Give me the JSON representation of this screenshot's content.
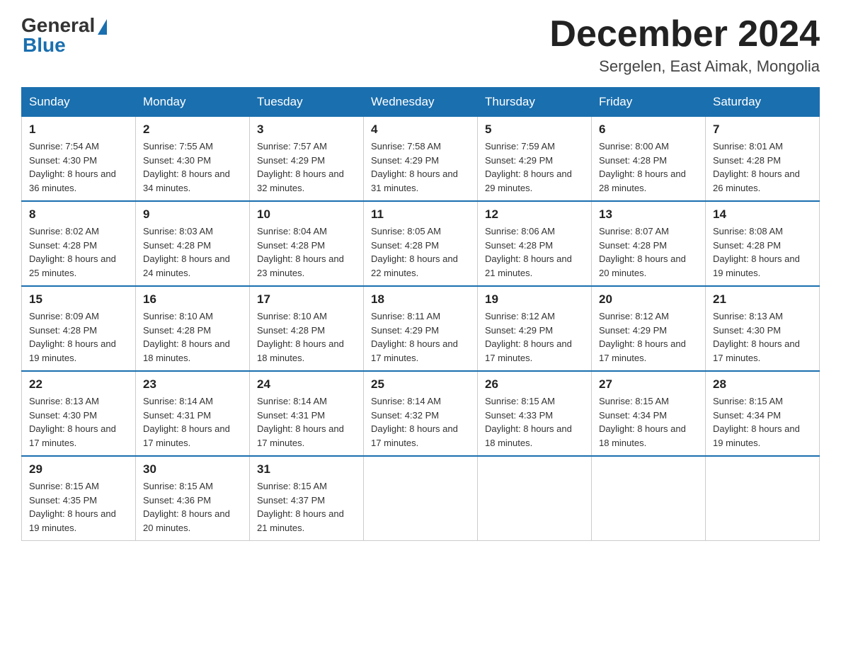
{
  "logo": {
    "general": "General",
    "blue": "Blue"
  },
  "title": "December 2024",
  "location": "Sergelen, East Aimak, Mongolia",
  "days_of_week": [
    "Sunday",
    "Monday",
    "Tuesday",
    "Wednesday",
    "Thursday",
    "Friday",
    "Saturday"
  ],
  "weeks": [
    [
      {
        "day": "1",
        "sunrise": "7:54 AM",
        "sunset": "4:30 PM",
        "daylight": "8 hours and 36 minutes."
      },
      {
        "day": "2",
        "sunrise": "7:55 AM",
        "sunset": "4:30 PM",
        "daylight": "8 hours and 34 minutes."
      },
      {
        "day": "3",
        "sunrise": "7:57 AM",
        "sunset": "4:29 PM",
        "daylight": "8 hours and 32 minutes."
      },
      {
        "day": "4",
        "sunrise": "7:58 AM",
        "sunset": "4:29 PM",
        "daylight": "8 hours and 31 minutes."
      },
      {
        "day": "5",
        "sunrise": "7:59 AM",
        "sunset": "4:29 PM",
        "daylight": "8 hours and 29 minutes."
      },
      {
        "day": "6",
        "sunrise": "8:00 AM",
        "sunset": "4:28 PM",
        "daylight": "8 hours and 28 minutes."
      },
      {
        "day": "7",
        "sunrise": "8:01 AM",
        "sunset": "4:28 PM",
        "daylight": "8 hours and 26 minutes."
      }
    ],
    [
      {
        "day": "8",
        "sunrise": "8:02 AM",
        "sunset": "4:28 PM",
        "daylight": "8 hours and 25 minutes."
      },
      {
        "day": "9",
        "sunrise": "8:03 AM",
        "sunset": "4:28 PM",
        "daylight": "8 hours and 24 minutes."
      },
      {
        "day": "10",
        "sunrise": "8:04 AM",
        "sunset": "4:28 PM",
        "daylight": "8 hours and 23 minutes."
      },
      {
        "day": "11",
        "sunrise": "8:05 AM",
        "sunset": "4:28 PM",
        "daylight": "8 hours and 22 minutes."
      },
      {
        "day": "12",
        "sunrise": "8:06 AM",
        "sunset": "4:28 PM",
        "daylight": "8 hours and 21 minutes."
      },
      {
        "day": "13",
        "sunrise": "8:07 AM",
        "sunset": "4:28 PM",
        "daylight": "8 hours and 20 minutes."
      },
      {
        "day": "14",
        "sunrise": "8:08 AM",
        "sunset": "4:28 PM",
        "daylight": "8 hours and 19 minutes."
      }
    ],
    [
      {
        "day": "15",
        "sunrise": "8:09 AM",
        "sunset": "4:28 PM",
        "daylight": "8 hours and 19 minutes."
      },
      {
        "day": "16",
        "sunrise": "8:10 AM",
        "sunset": "4:28 PM",
        "daylight": "8 hours and 18 minutes."
      },
      {
        "day": "17",
        "sunrise": "8:10 AM",
        "sunset": "4:28 PM",
        "daylight": "8 hours and 18 minutes."
      },
      {
        "day": "18",
        "sunrise": "8:11 AM",
        "sunset": "4:29 PM",
        "daylight": "8 hours and 17 minutes."
      },
      {
        "day": "19",
        "sunrise": "8:12 AM",
        "sunset": "4:29 PM",
        "daylight": "8 hours and 17 minutes."
      },
      {
        "day": "20",
        "sunrise": "8:12 AM",
        "sunset": "4:29 PM",
        "daylight": "8 hours and 17 minutes."
      },
      {
        "day": "21",
        "sunrise": "8:13 AM",
        "sunset": "4:30 PM",
        "daylight": "8 hours and 17 minutes."
      }
    ],
    [
      {
        "day": "22",
        "sunrise": "8:13 AM",
        "sunset": "4:30 PM",
        "daylight": "8 hours and 17 minutes."
      },
      {
        "day": "23",
        "sunrise": "8:14 AM",
        "sunset": "4:31 PM",
        "daylight": "8 hours and 17 minutes."
      },
      {
        "day": "24",
        "sunrise": "8:14 AM",
        "sunset": "4:31 PM",
        "daylight": "8 hours and 17 minutes."
      },
      {
        "day": "25",
        "sunrise": "8:14 AM",
        "sunset": "4:32 PM",
        "daylight": "8 hours and 17 minutes."
      },
      {
        "day": "26",
        "sunrise": "8:15 AM",
        "sunset": "4:33 PM",
        "daylight": "8 hours and 18 minutes."
      },
      {
        "day": "27",
        "sunrise": "8:15 AM",
        "sunset": "4:34 PM",
        "daylight": "8 hours and 18 minutes."
      },
      {
        "day": "28",
        "sunrise": "8:15 AM",
        "sunset": "4:34 PM",
        "daylight": "8 hours and 19 minutes."
      }
    ],
    [
      {
        "day": "29",
        "sunrise": "8:15 AM",
        "sunset": "4:35 PM",
        "daylight": "8 hours and 19 minutes."
      },
      {
        "day": "30",
        "sunrise": "8:15 AM",
        "sunset": "4:36 PM",
        "daylight": "8 hours and 20 minutes."
      },
      {
        "day": "31",
        "sunrise": "8:15 AM",
        "sunset": "4:37 PM",
        "daylight": "8 hours and 21 minutes."
      },
      null,
      null,
      null,
      null
    ]
  ]
}
